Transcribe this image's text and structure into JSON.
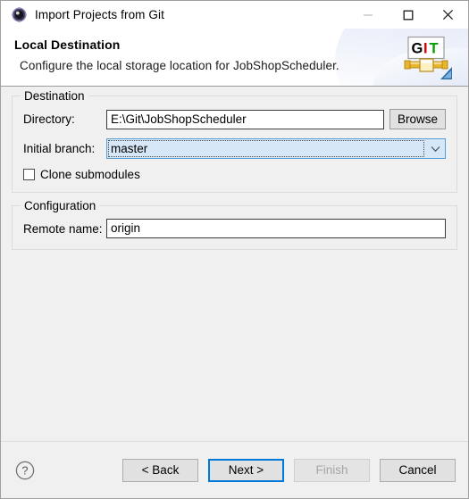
{
  "window": {
    "title": "Import Projects from Git",
    "icon": "eclipse-import-icon",
    "controls": {
      "minimize": "minimize-icon",
      "maximize": "maximize-icon",
      "close": "close-icon"
    }
  },
  "header": {
    "title": "Local Destination",
    "description": "Configure the local storage location for JobShopScheduler.",
    "logo": {
      "name": "git-logo",
      "letter_g": "G",
      "letter_i": "I",
      "letter_t": "T",
      "color_g": "#000000",
      "color_i": "#d40000",
      "color_t": "#00a000"
    }
  },
  "destination": {
    "legend": "Destination",
    "directory": {
      "label": "Directory:",
      "value": "E:\\Git\\JobShopScheduler",
      "placeholder": ""
    },
    "browse_label": "Browse",
    "initial_branch": {
      "label": "Initial branch:",
      "value": "master",
      "options": [
        "master"
      ]
    },
    "clone_submodules": {
      "label": "Clone submodules",
      "checked": false
    }
  },
  "configuration": {
    "legend": "Configuration",
    "remote_name": {
      "label": "Remote name:",
      "value": "origin",
      "placeholder": ""
    }
  },
  "footer": {
    "help_icon": "help-circle-icon",
    "buttons": {
      "back": "< Back",
      "next": "Next >",
      "finish": "Finish",
      "cancel": "Cancel"
    },
    "default_button": "Next >",
    "disabled_button": "Finish",
    "accent_color": "#0078d7"
  }
}
